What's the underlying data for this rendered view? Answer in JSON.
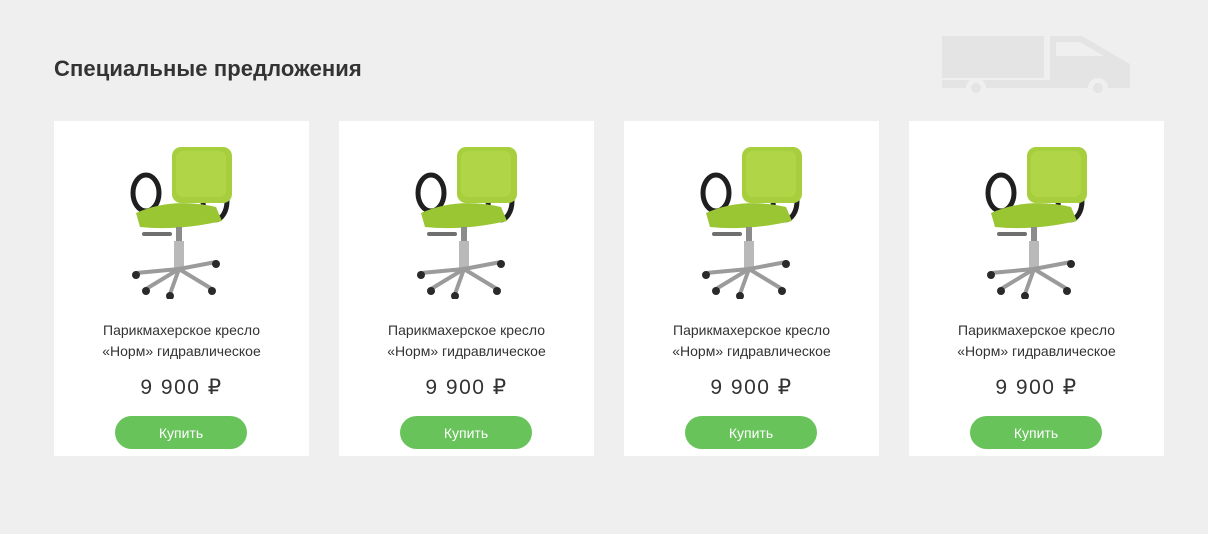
{
  "section": {
    "title": "Специальные предложения"
  },
  "decor": {
    "icon": "truck-icon",
    "color": "#e4e4e4"
  },
  "colors": {
    "background": "#efefef",
    "card": "#ffffff",
    "button": "#68c35b",
    "chair_seat": "#a7cf3d"
  },
  "products": [
    {
      "image_icon": "chair-image",
      "name_line1": "Парикмахерское кресло",
      "name_line2": "«Норм» гидравлическое",
      "price": "9 900 ₽",
      "buy_label": "Купить"
    },
    {
      "image_icon": "chair-image",
      "name_line1": "Парикмахерское кресло",
      "name_line2": "«Норм» гидравлическое",
      "price": "9 900 ₽",
      "buy_label": "Купить"
    },
    {
      "image_icon": "chair-image",
      "name_line1": "Парикмахерское кресло",
      "name_line2": "«Норм» гидравлическое",
      "price": "9 900 ₽",
      "buy_label": "Купить"
    },
    {
      "image_icon": "chair-image",
      "name_line1": "Парикмахерское кресло",
      "name_line2": "«Норм» гидравлическое",
      "price": "9 900 ₽",
      "buy_label": "Купить"
    }
  ]
}
